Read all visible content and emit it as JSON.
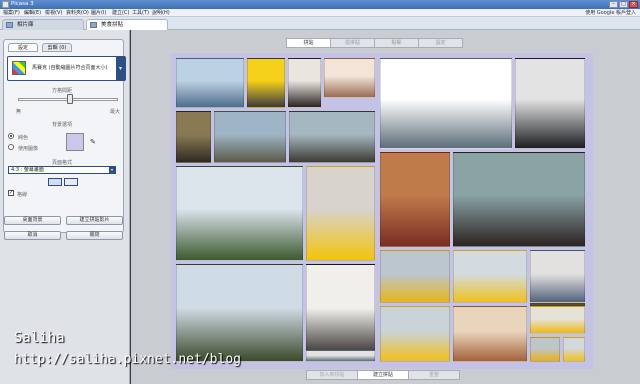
{
  "window": {
    "title": "Picasa 3"
  },
  "menu": {
    "items": [
      "檔案(F)",
      "編輯(E)",
      "檢視(V)",
      "資料夾(O)",
      "圖片(I)",
      "建立(C)",
      "工具(T)",
      "說明(H)"
    ],
    "google_text": "使用 Google 帳戶登入"
  },
  "tabs": [
    {
      "label": "相片庫",
      "active": false
    },
    {
      "label": "美食拼貼",
      "active": true
    }
  ],
  "panel": {
    "tab_settings": "設定",
    "tab_clips": "剪輯 (0)",
    "layout_text": "馬賽克 (自動縮圖片符合頁面大小)",
    "spacing_label": "方格間距",
    "spacing_min": "無",
    "spacing_max": "最大",
    "spacing_fraction": 0.52,
    "bg_label": "背景選項",
    "bg_solid": "純色",
    "bg_image": "使用圖像",
    "bg_color": "#c9c8ea",
    "format_label": "頁面格式",
    "aspect_value": "4:3 : 螢幕畫面",
    "grid_label": "格線",
    "btn_desktop": "桌面背景",
    "btn_create": "建立拼貼影片",
    "btn_cancel": "取消",
    "btn_close": "關閉"
  },
  "main": {
    "top_buttons": [
      "拼貼",
      "從拼貼",
      "點擊",
      "設定"
    ],
    "bottom_buttons": [
      "加入到拼貼",
      "建立拼貼",
      "重整"
    ]
  },
  "watermark": {
    "name": "Saliha",
    "url": "http://saliha.pixnet.net/blog"
  },
  "photos": [
    {
      "desc": "seaside",
      "c1": "#bcd1e3",
      "c2": "#4d6f8a"
    },
    {
      "desc": "duck-with-girl",
      "c1": "#f5d11a",
      "c2": "#3c3a3f"
    },
    {
      "desc": "girl-selfie",
      "c1": "#e9e6e0",
      "c2": "#2b2321"
    },
    {
      "desc": "dessert-plate",
      "c1": "#f2e4d6",
      "c2": "#9b6d55"
    },
    {
      "desc": "harbor-couple",
      "c1": "#ffffff",
      "c2": "#5c6e7a"
    },
    {
      "desc": "boy-cup",
      "c1": "#e3e3e3",
      "c2": "#1d1f22"
    },
    {
      "desc": "girl-hat",
      "c1": "#8a7a53",
      "c2": "#2f2a22"
    },
    {
      "desc": "man-on-rocks",
      "c1": "#9fb4c4",
      "c2": "#5a5a4a"
    },
    {
      "desc": "girl-sitting-rock",
      "c1": "#a5b7c0",
      "c2": "#3e3c34"
    },
    {
      "desc": "green-seaweed-shore",
      "c1": "#dce4ec",
      "c2": "#3c5a2f"
    },
    {
      "desc": "duck-sea",
      "c1": "#d8d3cc",
      "c2": "#f3c40c"
    },
    {
      "desc": "cafe-girl",
      "c1": "#c07b4a",
      "c2": "#7b2d23"
    },
    {
      "desc": "cafe-boy",
      "c1": "#8aa3a5",
      "c2": "#2c2322"
    },
    {
      "desc": "man-shore",
      "c1": "#cfdbe5",
      "c2": "#3c4a2c"
    },
    {
      "desc": "girl-eating",
      "c1": "#f0efe9",
      "c2": "#1f1a18"
    },
    {
      "desc": "harbor-duck",
      "c1": "#bcc6cf",
      "c2": "#e9b518"
    },
    {
      "desc": "harbor-duck-2",
      "c1": "#d3dbe0",
      "c2": "#f0c21b"
    },
    {
      "desc": "harbor-view",
      "c1": "#e3e1df",
      "c2": "#53627b"
    },
    {
      "desc": "duck-water",
      "c1": "#cad3d8",
      "c2": "#f2c01b"
    },
    {
      "desc": "dessert",
      "c1": "#e9d5bc",
      "c2": "#a4623b"
    },
    {
      "desc": "ducks-group",
      "c1": "#e5e3d7",
      "c2": "#edb919"
    },
    {
      "desc": "duck-close",
      "c1": "#bfc6c8",
      "c2": "#eab014"
    },
    {
      "desc": "small-duck",
      "c1": "#d3d8da",
      "c2": "#f3c114"
    },
    {
      "desc": "harbor-rain",
      "c1": "#e1e3e4",
      "c2": "#5d6b73"
    },
    {
      "desc": "duck-night",
      "c1": "#2b2a26",
      "c2": "#e0b314"
    }
  ]
}
